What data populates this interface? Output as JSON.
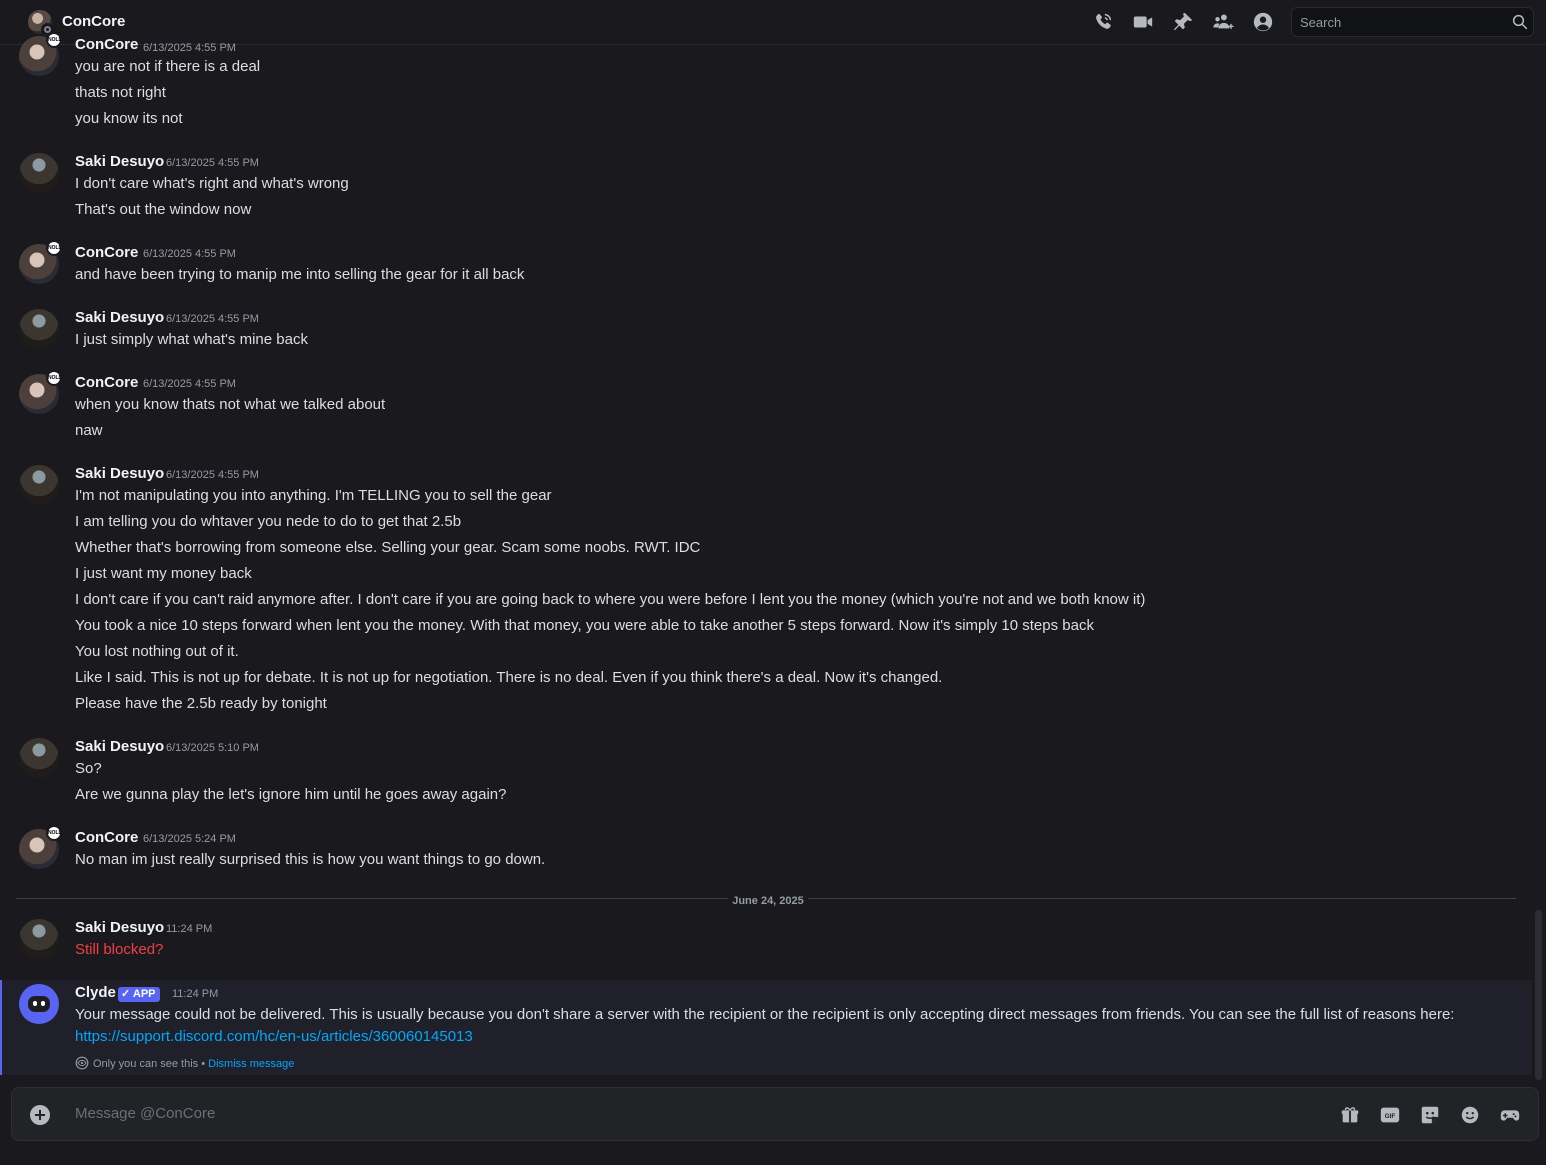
{
  "header": {
    "title": "ConCore",
    "search_placeholder": "Search",
    "icons": [
      "voice-call-icon",
      "video-call-icon",
      "pinned-messages-icon",
      "add-friends-to-dm-icon",
      "user-profile-icon"
    ]
  },
  "messages": [
    {
      "user": "ConCore",
      "timestamp": "6/13/2025 4:55 PM",
      "lines": [
        "you are not if there is a deal",
        "thats not right",
        "you know its not"
      ]
    },
    {
      "user": "Saki Desuyo",
      "timestamp": "6/13/2025 4:55 PM",
      "lines": [
        "I don't care what's right and what's wrong",
        "That's out the window now"
      ]
    },
    {
      "user": "ConCore",
      "timestamp": "6/13/2025 4:55 PM",
      "lines": [
        "and have been trying to manip me into selling the gear for it all back"
      ]
    },
    {
      "user": "Saki Desuyo",
      "timestamp": "6/13/2025 4:55 PM",
      "lines": [
        "I just simply what what's mine back"
      ]
    },
    {
      "user": "ConCore",
      "timestamp": "6/13/2025 4:55 PM",
      "lines": [
        "when you know thats not what we talked about",
        "naw"
      ]
    },
    {
      "user": "Saki Desuyo",
      "timestamp": "6/13/2025 4:55 PM",
      "lines": [
        "I'm not manipulating you into anything. I'm TELLING you to sell the gear",
        "I am telling you do whtaver you nede to do to get that 2.5b",
        "Whether that's borrowing from someone else. Selling your gear. Scam some noobs. RWT. IDC",
        "I just want my money back",
        "I don't care if you can't raid anymore after. I don't care if you are going back to where you were before I lent you the money (which you're not and we both know it)",
        "You took a nice 10 steps forward when lent you the money. With that money, you were able to take another 5 steps forward. Now it's simply 10 steps back",
        "You lost nothing out of it.",
        "Like I said. This is not up for debate. It is not up for negotiation. There is no deal. Even if you think there's a deal. Now it's changed.",
        "Please have the 2.5b ready by tonight"
      ]
    },
    {
      "user": "Saki Desuyo",
      "timestamp": "6/13/2025 5:10 PM",
      "lines": [
        "So?",
        "Are we gunna play the let's ignore him until he goes away again?"
      ]
    },
    {
      "user": "ConCore",
      "timestamp": "6/13/2025 5:24 PM",
      "lines": [
        "No man im just really surprised this is how you want things to go down."
      ]
    },
    {
      "user": "Saki Desuyo",
      "timestamp": "11:24 PM",
      "lines": [
        "Still blocked?"
      ]
    },
    {
      "user": "Clyde",
      "tag": "APP",
      "timestamp": "11:24 PM",
      "lines": [
        "Your message could not be delivered. This is usually because you don't share a server with the recipient or the recipient is only accepting direct messages from friends. You can see the full list of reasons here:",
        "https://support.discord.com/hc/en-us/articles/360060145013"
      ]
    }
  ],
  "date_divider": "June 24, 2025",
  "ephemeral": {
    "note": "Only you can see this • ",
    "dismiss": "Dismiss message"
  },
  "composer": {
    "placeholder": "Message @ConCore",
    "icons": [
      "gift-icon",
      "gif-icon",
      "sticker-icon",
      "emoji-icon",
      "activities-icon"
    ]
  },
  "colors": {
    "accent": "#5865f2",
    "link": "#00a8fc",
    "failed": "#f23f43",
    "background": "#1a1a1e"
  }
}
